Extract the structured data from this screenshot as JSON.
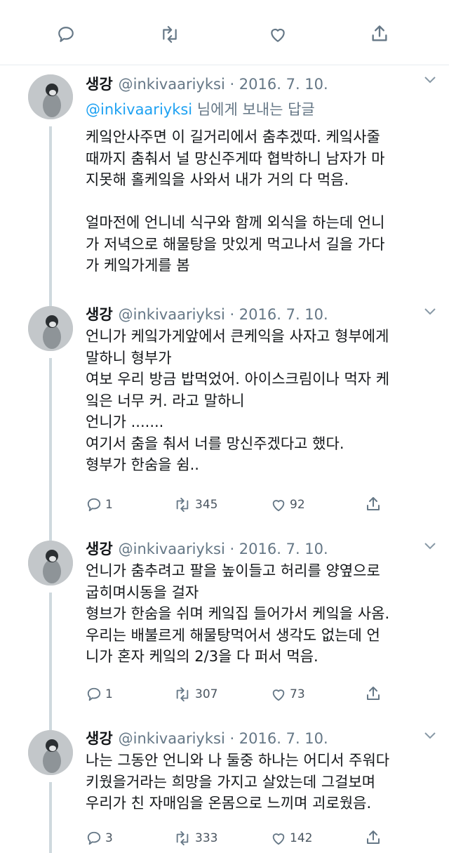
{
  "top_actions": {
    "icons": [
      "reply-icon",
      "retweet-icon",
      "like-icon",
      "share-icon"
    ]
  },
  "reply_to": {
    "mention": "@inkivaariyksi",
    "suffix": " 님에게 보내는 답글"
  },
  "tweets": [
    {
      "name": "생강",
      "handle": "@inkivaariyksi · 2016. 7. 10.",
      "lines": [
        "케잌안사주면 이 길거리에서 춤추겠따. 케잌사줄",
        "때까지 춤춰서 널 망신주게따 협박하니 남자가 마",
        "지못해 홀케잌을 사와서 내가 거의 다 먹음.",
        "",
        "얼마전에 언니네 식구와 함께 외식을 하는데 언니",
        "가 저녁으로 해물탕을 맛있게 먹고나서 길을 가다",
        "가 케잌가게를 봄"
      ]
    },
    {
      "name": "생강",
      "handle": "@inkivaariyksi · 2016. 7. 10.",
      "lines": [
        "언니가 케잌가게앞에서 큰케익을 사자고 형부에게",
        "말하니 형부가",
        "여보 우리 방금 밥먹었어. 아이스크림이나 먹자 케",
        "잌은 너무 커. 라고 말하니",
        "언니가 .......",
        "여기서 춤을 춰서 너를 망신주겠다고 했다.",
        "형부가 한숨을 쉼.."
      ],
      "stats": {
        "replies": "1",
        "retweets": "345",
        "likes": "92"
      }
    },
    {
      "name": "생강",
      "handle": "@inkivaariyksi · 2016. 7. 10.",
      "lines": [
        "언니가 춤추려고  팔을 높이들고 허리를 양옆으로",
        "굽히며시동을 걸자",
        "형브가 한숨을 쉬며 케잌집 들어가서 케잌을 사옴.",
        "우리는 배불르게 해물탕먹어서 생각도 없는데 언",
        "니가 혼자 케잌의 2/3을 다 퍼서 먹음."
      ],
      "stats": {
        "replies": "1",
        "retweets": "307",
        "likes": "73"
      }
    },
    {
      "name": "생강",
      "handle": "@inkivaariyksi · 2016. 7. 10.",
      "lines": [
        "나는 그동안 언니와 나 둘중 하나는 어디서 주워다",
        "키웠을거라는 희망을 가지고 살았는데  그걸보며",
        "우리가 친 자매임을 온몸으로 느끼며 괴로웠음."
      ],
      "stats": {
        "replies": "3",
        "retweets": "333",
        "likes": "142"
      }
    }
  ]
}
